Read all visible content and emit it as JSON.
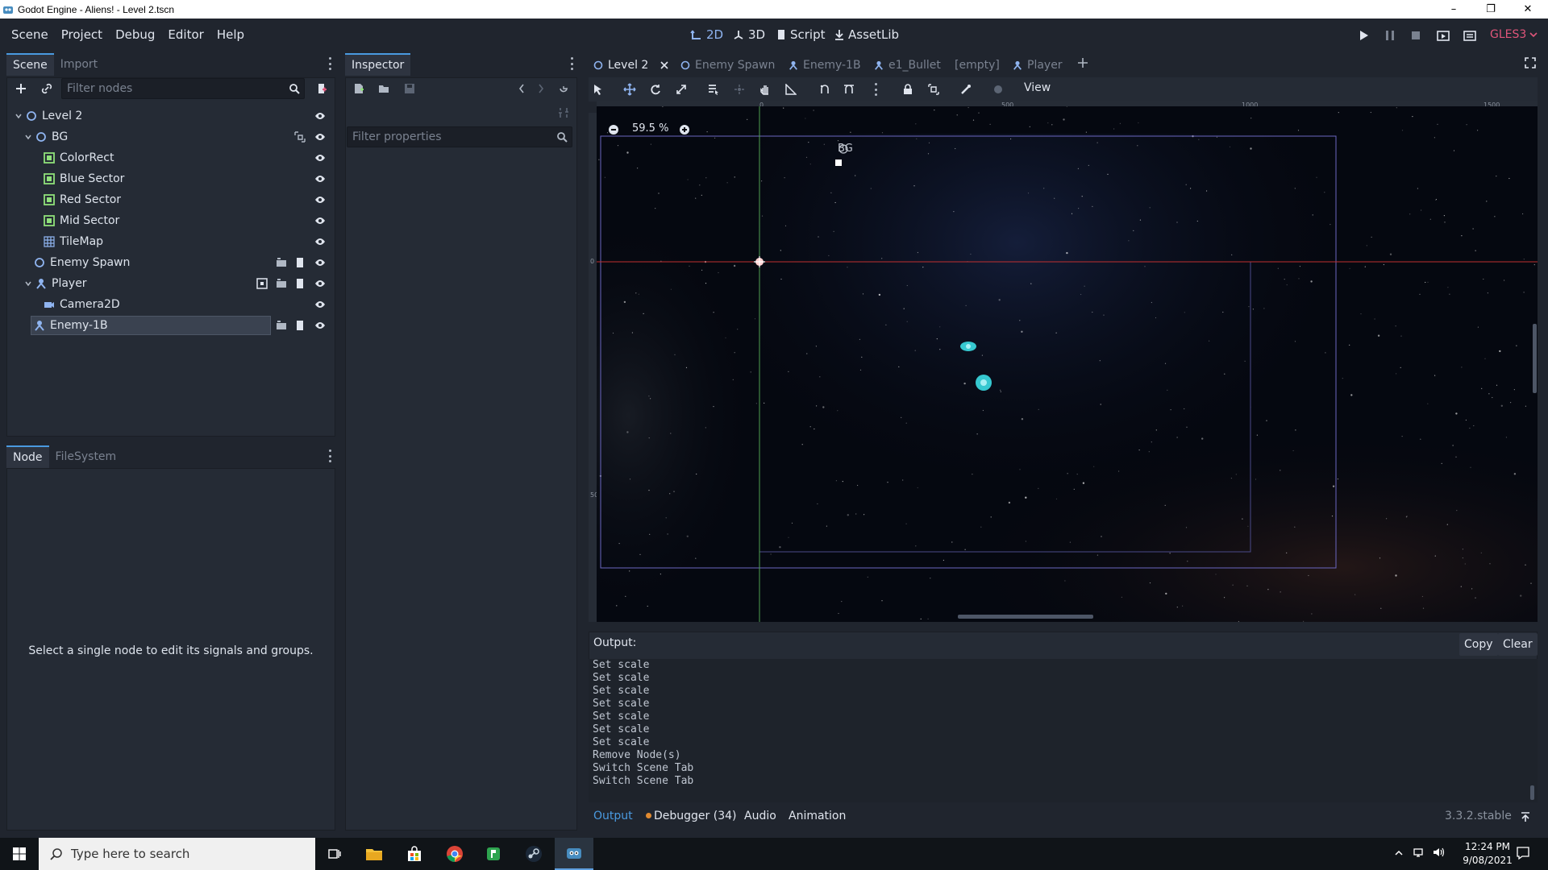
{
  "window": {
    "title": "Godot Engine - Aliens! - Level 2.tscn"
  },
  "menu": [
    "Scene",
    "Project",
    "Debug",
    "Editor",
    "Help"
  ],
  "workspaces": [
    "2D",
    "3D",
    "Script",
    "AssetLib"
  ],
  "renderer": "GLES3",
  "scene_dock": {
    "tabs": [
      "Scene",
      "Import"
    ],
    "filter_placeholder": "Filter nodes",
    "tree": [
      {
        "name": "Level 2",
        "type": "node2d",
        "depth": 0,
        "expanded": true
      },
      {
        "name": "BG",
        "type": "node2d",
        "depth": 1,
        "expanded": true
      },
      {
        "name": "ColorRect",
        "type": "control",
        "depth": 2
      },
      {
        "name": "Blue Sector",
        "type": "control",
        "depth": 2
      },
      {
        "name": "Red Sector",
        "type": "control",
        "depth": 2
      },
      {
        "name": "Mid Sector",
        "type": "control",
        "depth": 2
      },
      {
        "name": "TileMap",
        "type": "tilemap",
        "depth": 2
      },
      {
        "name": "Enemy Spawn",
        "type": "node2d",
        "depth": 1
      },
      {
        "name": "Player",
        "type": "kinematic",
        "depth": 1,
        "expanded": true
      },
      {
        "name": "Camera2D",
        "type": "camera",
        "depth": 2
      },
      {
        "name": "Enemy-1B",
        "type": "kinematic",
        "depth": 1,
        "selected": true
      }
    ]
  },
  "node_dock": {
    "tabs": [
      "Node",
      "FileSystem"
    ],
    "message": "Select a single node to edit its signals and groups."
  },
  "inspector": {
    "tab": "Inspector",
    "filter_placeholder": "Filter properties"
  },
  "editor_tabs": [
    "Level 2",
    "Enemy Spawn",
    "Enemy-1B",
    "e1_Bullet",
    "[empty]",
    "Player"
  ],
  "toolbar": {
    "view_label": "View",
    "zoom_label": "59.5 %"
  },
  "canvas": {
    "ruler_labels": [
      "0",
      "500",
      "1000",
      "1500"
    ],
    "vertical_ruler_labels": [
      "0",
      "500"
    ],
    "bg_label": "BG"
  },
  "output": {
    "label": "Output:",
    "copy_label": "Copy",
    "clear_label": "Clear",
    "lines": [
      "Set scale",
      "Set scale",
      "Set scale",
      "Set scale",
      "Set scale",
      "Set scale",
      "Set scale",
      "Remove Node(s)",
      "Switch Scene Tab",
      "Switch Scene Tab"
    ],
    "bottom_tabs": [
      "Output",
      "Debugger (34)",
      "Audio",
      "Animation"
    ],
    "version": "3.3.2.stable"
  },
  "taskbar": {
    "search_placeholder": "Type here to search",
    "time": "12:24 PM",
    "date": "9/08/2021"
  },
  "colors": {
    "accent": "#4a9ae0",
    "renderer": "#e0557a",
    "node2d": "#8fb4f0",
    "control": "#8fe07a",
    "kinematic": "#8fb4f0"
  }
}
